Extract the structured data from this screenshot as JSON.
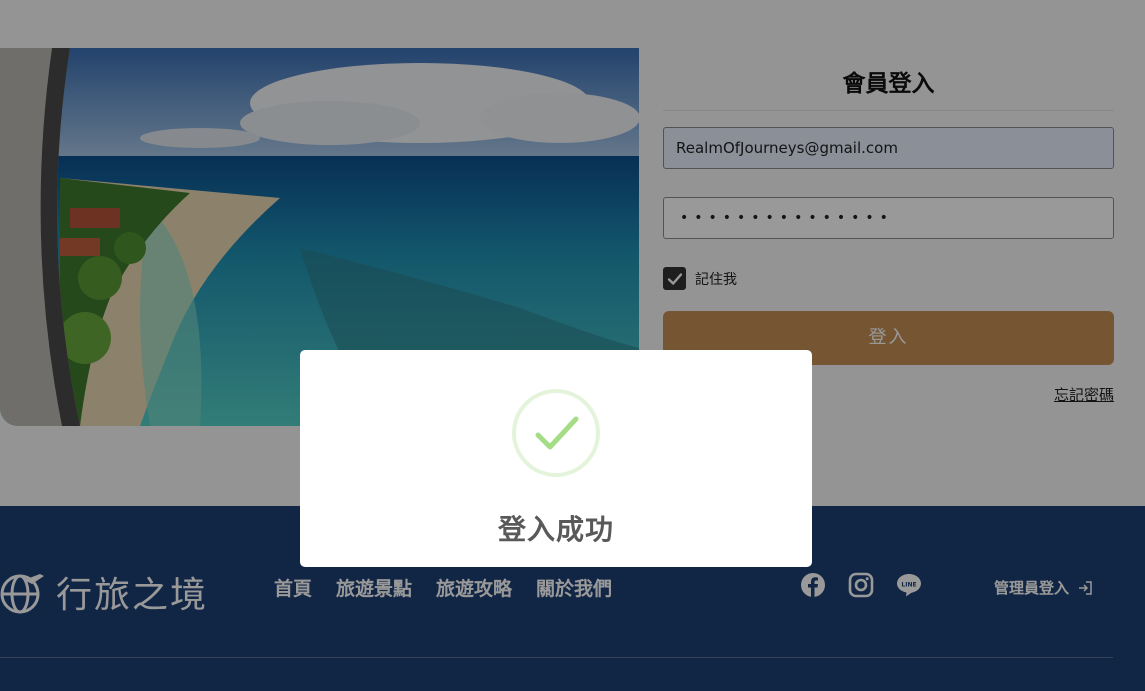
{
  "login": {
    "title": "會員登入",
    "email_value": "RealmOfJourneys@gmail.com",
    "password_value": "•••••••••••••••",
    "remember_label": "記住我",
    "remember_checked": true,
    "submit_label": "登入",
    "forgot_label": "忘記密碼"
  },
  "footer": {
    "brand_name": "行旅之境",
    "nav": [
      "首頁",
      "旅遊景點",
      "旅遊攻略",
      "關於我們"
    ],
    "social_icons": [
      "facebook-icon",
      "instagram-icon",
      "line-icon"
    ],
    "admin_label": "管理員登入"
  },
  "modal": {
    "title": "登入成功",
    "icon": "success-check-icon"
  },
  "colors": {
    "footer_bg": "#1d3f74",
    "button_bg": "#c58e56",
    "success_green": "#a5dc86"
  }
}
